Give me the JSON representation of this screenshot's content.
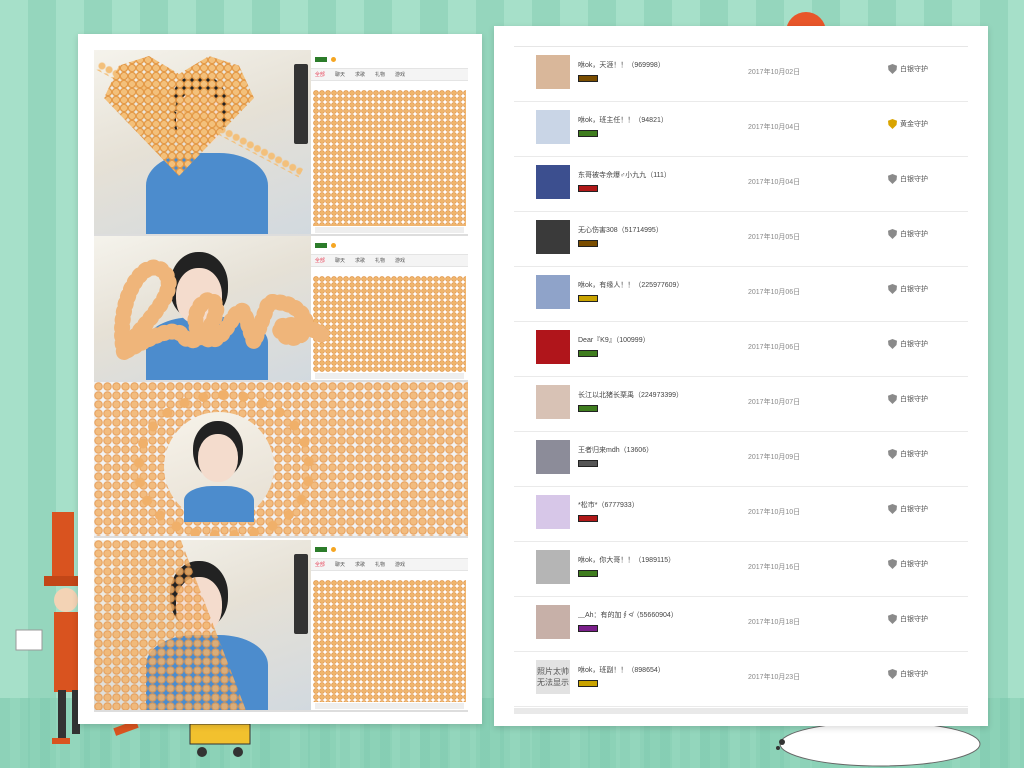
{
  "guard_list": {
    "rows": [
      {
        "name": "咻ok，天涯！！（969998）",
        "date": "2017年10月02日",
        "guard": "白银守护",
        "guard_color": "#8a8a8a",
        "badge_color": "#7a4d00",
        "avatar_bg": "#d9b79a"
      },
      {
        "name": "咻ok，班主任！！（94821）",
        "date": "2017年10月04日",
        "guard": "黄金守护",
        "guard_color": "#d9a400",
        "badge_color": "#3f7d1e",
        "avatar_bg": "#c9d5e6"
      },
      {
        "name": "东哥被寺佘爆♂小九九（111）",
        "date": "2017年10月04日",
        "guard": "白银守护",
        "guard_color": "#8a8a8a",
        "badge_color": "#b01818",
        "avatar_bg": "#3c4f8f"
      },
      {
        "name": "无心伤害308（51714995）",
        "date": "2017年10月05日",
        "guard": "白银守护",
        "guard_color": "#8a8a8a",
        "badge_color": "#7a4d00",
        "avatar_bg": "#3a3a3a"
      },
      {
        "name": "咻ok，有缘人！！（225977609）",
        "date": "2017年10月06日",
        "guard": "白银守护",
        "guard_color": "#8a8a8a",
        "badge_color": "#c9a300",
        "avatar_bg": "#8fa3c9"
      },
      {
        "name": "Dear『K9』（100999）",
        "date": "2017年10月06日",
        "guard": "白银守护",
        "guard_color": "#8a8a8a",
        "badge_color": "#3f7d1e",
        "avatar_bg": "#b0151b"
      },
      {
        "name": "长江以北猪长栗禹（224973399）",
        "date": "2017年10月07日",
        "guard": "白银守护",
        "guard_color": "#8a8a8a",
        "badge_color": "#3f7d1e",
        "avatar_bg": "#d8c2b5"
      },
      {
        "name": "王者归来mdh（13606）",
        "date": "2017年10月09日",
        "guard": "白银守护",
        "guard_color": "#8a8a8a",
        "badge_color": "#555555",
        "avatar_bg": "#8c8c99"
      },
      {
        "name": "*松市*（6777933）",
        "date": "2017年10月10日",
        "guard": "白银守护",
        "guard_color": "#8a8a8a",
        "badge_color": "#b01818",
        "avatar_bg": "#d7c7e8"
      },
      {
        "name": "咻ok，你大哥！！（1989115）",
        "date": "2017年10月16日",
        "guard": "白银守护",
        "guard_color": "#8a8a8a",
        "badge_color": "#3f7d1e",
        "avatar_bg": "#b5b5b5"
      },
      {
        "name": "﹏Ah：有的加∮≮（55660904）",
        "date": "2017年10月18日",
        "guard": "白银守护",
        "guard_color": "#8a8a8a",
        "badge_color": "#7a1f8a",
        "avatar_bg": "#c7b0a8"
      },
      {
        "name": "咻ok，班副！！（898654）",
        "date": "2017年10月23日",
        "guard": "白银守护",
        "guard_color": "#8a8a8a",
        "badge_color": "#c9a300",
        "avatar_bg": "#e2e2e2",
        "avatar_text": "照片太帅\n无法显示"
      }
    ]
  },
  "screenshots": {
    "panel_tabs": [
      "全部",
      "聊天",
      "求歌",
      "礼物",
      "游戏"
    ]
  }
}
